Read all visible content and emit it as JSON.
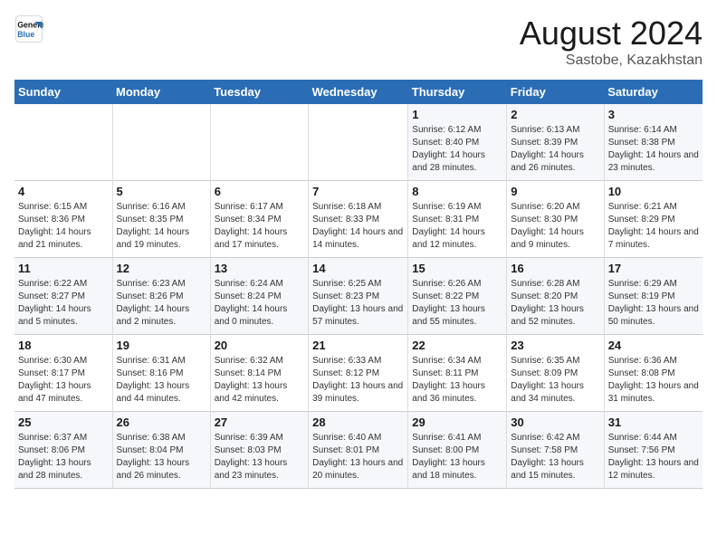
{
  "header": {
    "logo_line1": "General",
    "logo_line2": "Blue",
    "main_title": "August 2024",
    "subtitle": "Sastobe, Kazakhstan"
  },
  "weekdays": [
    "Sunday",
    "Monday",
    "Tuesday",
    "Wednesday",
    "Thursday",
    "Friday",
    "Saturday"
  ],
  "weeks": [
    [
      {
        "day": "",
        "info": ""
      },
      {
        "day": "",
        "info": ""
      },
      {
        "day": "",
        "info": ""
      },
      {
        "day": "",
        "info": ""
      },
      {
        "day": "1",
        "info": "Sunrise: 6:12 AM\nSunset: 8:40 PM\nDaylight: 14 hours and 28 minutes."
      },
      {
        "day": "2",
        "info": "Sunrise: 6:13 AM\nSunset: 8:39 PM\nDaylight: 14 hours and 26 minutes."
      },
      {
        "day": "3",
        "info": "Sunrise: 6:14 AM\nSunset: 8:38 PM\nDaylight: 14 hours and 23 minutes."
      }
    ],
    [
      {
        "day": "4",
        "info": "Sunrise: 6:15 AM\nSunset: 8:36 PM\nDaylight: 14 hours and 21 minutes."
      },
      {
        "day": "5",
        "info": "Sunrise: 6:16 AM\nSunset: 8:35 PM\nDaylight: 14 hours and 19 minutes."
      },
      {
        "day": "6",
        "info": "Sunrise: 6:17 AM\nSunset: 8:34 PM\nDaylight: 14 hours and 17 minutes."
      },
      {
        "day": "7",
        "info": "Sunrise: 6:18 AM\nSunset: 8:33 PM\nDaylight: 14 hours and 14 minutes."
      },
      {
        "day": "8",
        "info": "Sunrise: 6:19 AM\nSunset: 8:31 PM\nDaylight: 14 hours and 12 minutes."
      },
      {
        "day": "9",
        "info": "Sunrise: 6:20 AM\nSunset: 8:30 PM\nDaylight: 14 hours and 9 minutes."
      },
      {
        "day": "10",
        "info": "Sunrise: 6:21 AM\nSunset: 8:29 PM\nDaylight: 14 hours and 7 minutes."
      }
    ],
    [
      {
        "day": "11",
        "info": "Sunrise: 6:22 AM\nSunset: 8:27 PM\nDaylight: 14 hours and 5 minutes."
      },
      {
        "day": "12",
        "info": "Sunrise: 6:23 AM\nSunset: 8:26 PM\nDaylight: 14 hours and 2 minutes."
      },
      {
        "day": "13",
        "info": "Sunrise: 6:24 AM\nSunset: 8:24 PM\nDaylight: 14 hours and 0 minutes."
      },
      {
        "day": "14",
        "info": "Sunrise: 6:25 AM\nSunset: 8:23 PM\nDaylight: 13 hours and 57 minutes."
      },
      {
        "day": "15",
        "info": "Sunrise: 6:26 AM\nSunset: 8:22 PM\nDaylight: 13 hours and 55 minutes."
      },
      {
        "day": "16",
        "info": "Sunrise: 6:28 AM\nSunset: 8:20 PM\nDaylight: 13 hours and 52 minutes."
      },
      {
        "day": "17",
        "info": "Sunrise: 6:29 AM\nSunset: 8:19 PM\nDaylight: 13 hours and 50 minutes."
      }
    ],
    [
      {
        "day": "18",
        "info": "Sunrise: 6:30 AM\nSunset: 8:17 PM\nDaylight: 13 hours and 47 minutes."
      },
      {
        "day": "19",
        "info": "Sunrise: 6:31 AM\nSunset: 8:16 PM\nDaylight: 13 hours and 44 minutes."
      },
      {
        "day": "20",
        "info": "Sunrise: 6:32 AM\nSunset: 8:14 PM\nDaylight: 13 hours and 42 minutes."
      },
      {
        "day": "21",
        "info": "Sunrise: 6:33 AM\nSunset: 8:12 PM\nDaylight: 13 hours and 39 minutes."
      },
      {
        "day": "22",
        "info": "Sunrise: 6:34 AM\nSunset: 8:11 PM\nDaylight: 13 hours and 36 minutes."
      },
      {
        "day": "23",
        "info": "Sunrise: 6:35 AM\nSunset: 8:09 PM\nDaylight: 13 hours and 34 minutes."
      },
      {
        "day": "24",
        "info": "Sunrise: 6:36 AM\nSunset: 8:08 PM\nDaylight: 13 hours and 31 minutes."
      }
    ],
    [
      {
        "day": "25",
        "info": "Sunrise: 6:37 AM\nSunset: 8:06 PM\nDaylight: 13 hours and 28 minutes."
      },
      {
        "day": "26",
        "info": "Sunrise: 6:38 AM\nSunset: 8:04 PM\nDaylight: 13 hours and 26 minutes."
      },
      {
        "day": "27",
        "info": "Sunrise: 6:39 AM\nSunset: 8:03 PM\nDaylight: 13 hours and 23 minutes."
      },
      {
        "day": "28",
        "info": "Sunrise: 6:40 AM\nSunset: 8:01 PM\nDaylight: 13 hours and 20 minutes."
      },
      {
        "day": "29",
        "info": "Sunrise: 6:41 AM\nSunset: 8:00 PM\nDaylight: 13 hours and 18 minutes."
      },
      {
        "day": "30",
        "info": "Sunrise: 6:42 AM\nSunset: 7:58 PM\nDaylight: 13 hours and 15 minutes."
      },
      {
        "day": "31",
        "info": "Sunrise: 6:44 AM\nSunset: 7:56 PM\nDaylight: 13 hours and 12 minutes."
      }
    ]
  ]
}
